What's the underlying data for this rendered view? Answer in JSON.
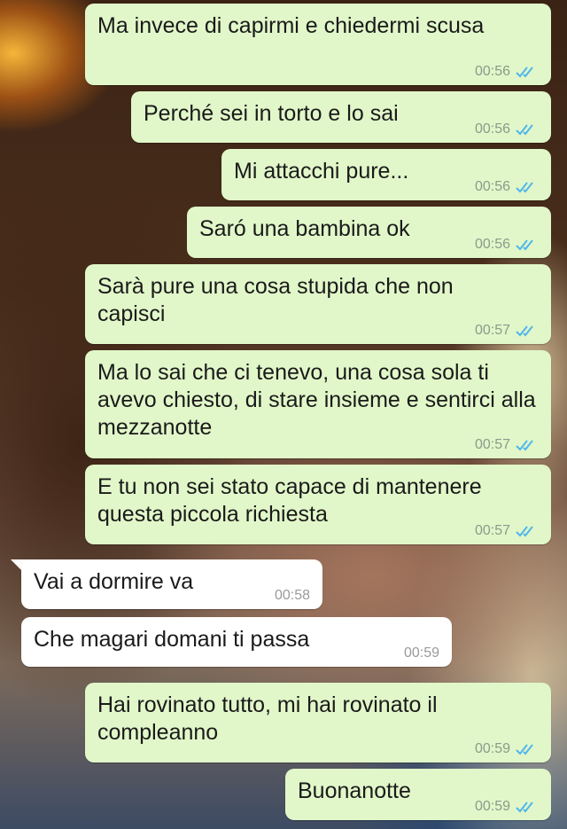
{
  "colors": {
    "outgoing_bubble": "#e1f7c9",
    "incoming_bubble": "#ffffff",
    "read_ticks": "#4fb6ec"
  },
  "messages": [
    {
      "direction": "out",
      "text": "Ma invece di capirmi e chiedermi scusa",
      "time": "00:56",
      "status": "read"
    },
    {
      "direction": "out",
      "text": "Perché sei in torto e lo sai",
      "time": "00:56",
      "status": "read"
    },
    {
      "direction": "out",
      "text": "Mi attacchi pure...",
      "time": "00:56",
      "status": "read"
    },
    {
      "direction": "out",
      "text": "Saró una bambina ok",
      "time": "00:56",
      "status": "read"
    },
    {
      "direction": "out",
      "text": "Sarà pure una cosa stupida che non capisci",
      "time": "00:57",
      "status": "read"
    },
    {
      "direction": "out",
      "text": "Ma lo sai che ci tenevo, una cosa sola ti avevo chiesto, di stare insieme e sentirci alla mezzanotte",
      "time": "00:57",
      "status": "read"
    },
    {
      "direction": "out",
      "text": "E tu non sei stato capace di mantenere questa piccola richiesta",
      "time": "00:57",
      "status": "read"
    },
    {
      "direction": "in",
      "text": "Vai a dormire va",
      "time": "00:58"
    },
    {
      "direction": "in",
      "text": "Che magari domani ti passa",
      "time": "00:59"
    },
    {
      "direction": "out",
      "text": "Hai rovinato tutto, mi hai rovinato il compleanno",
      "time": "00:59",
      "status": "read"
    },
    {
      "direction": "out",
      "text": "Buonanotte",
      "time": "00:59",
      "status": "read"
    }
  ]
}
